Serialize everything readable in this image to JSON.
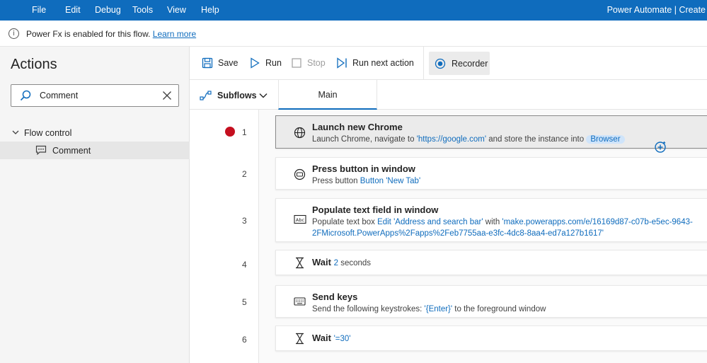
{
  "menu": {
    "items": [
      "File",
      "Edit",
      "Debug",
      "Tools",
      "View",
      "Help"
    ],
    "app_title": "Power Automate | Create"
  },
  "info_bar": {
    "text": "Power Fx is enabled for this flow.",
    "link": "Learn more"
  },
  "actions_panel": {
    "title": "Actions",
    "search_value": "Comment",
    "group_label": "Flow control",
    "item_label": "Comment"
  },
  "toolbar": {
    "save": "Save",
    "run": "Run",
    "stop": "Stop",
    "run_next": "Run next action",
    "recorder": "Recorder"
  },
  "tabs": {
    "subflows": "Subflows",
    "main": "Main"
  },
  "colors": {
    "accent": "#0f6cbd",
    "breakpoint": "#c50f1f",
    "variable_badge_bg": "#cfe4fa"
  },
  "steps": [
    {
      "number": "1",
      "icon": "globe-icon",
      "title": "Launch new Chrome",
      "desc": {
        "p1": "Launch Chrome, navigate to ",
        "v1": "'https://google.com'",
        "p2": " and store the instance into ",
        "var": "Browser"
      }
    },
    {
      "number": "2",
      "icon": "button-icon",
      "title": "Press button in window",
      "desc": {
        "p1": "Press button ",
        "v1": "Button 'New Tab'"
      }
    },
    {
      "number": "3",
      "icon": "textbox-icon",
      "title": "Populate text field in window",
      "desc": {
        "p1": "Populate text box ",
        "v1": "Edit 'Address and search bar'",
        "p2": " with ",
        "v2": "'make.powerapps.com/e/16169d87-c07b-e5ec-9643-",
        "line2": "2FMicrosoft.PowerApps%2Fapps%2Feb7755aa-e3fc-4dc8-8aa4-ed7a127b1617'"
      }
    },
    {
      "number": "4",
      "icon": "hourglass-icon",
      "title": "Wait",
      "value": "2",
      "suffix": " seconds"
    },
    {
      "number": "5",
      "icon": "keyboard-icon",
      "title": "Send keys",
      "desc": {
        "p1": "Send the following keystrokes: ",
        "v1": "'{Enter}'",
        "p2": " to the foreground window"
      }
    },
    {
      "number": "6",
      "icon": "hourglass-icon",
      "title": "Wait",
      "value": "'=30'"
    }
  ]
}
